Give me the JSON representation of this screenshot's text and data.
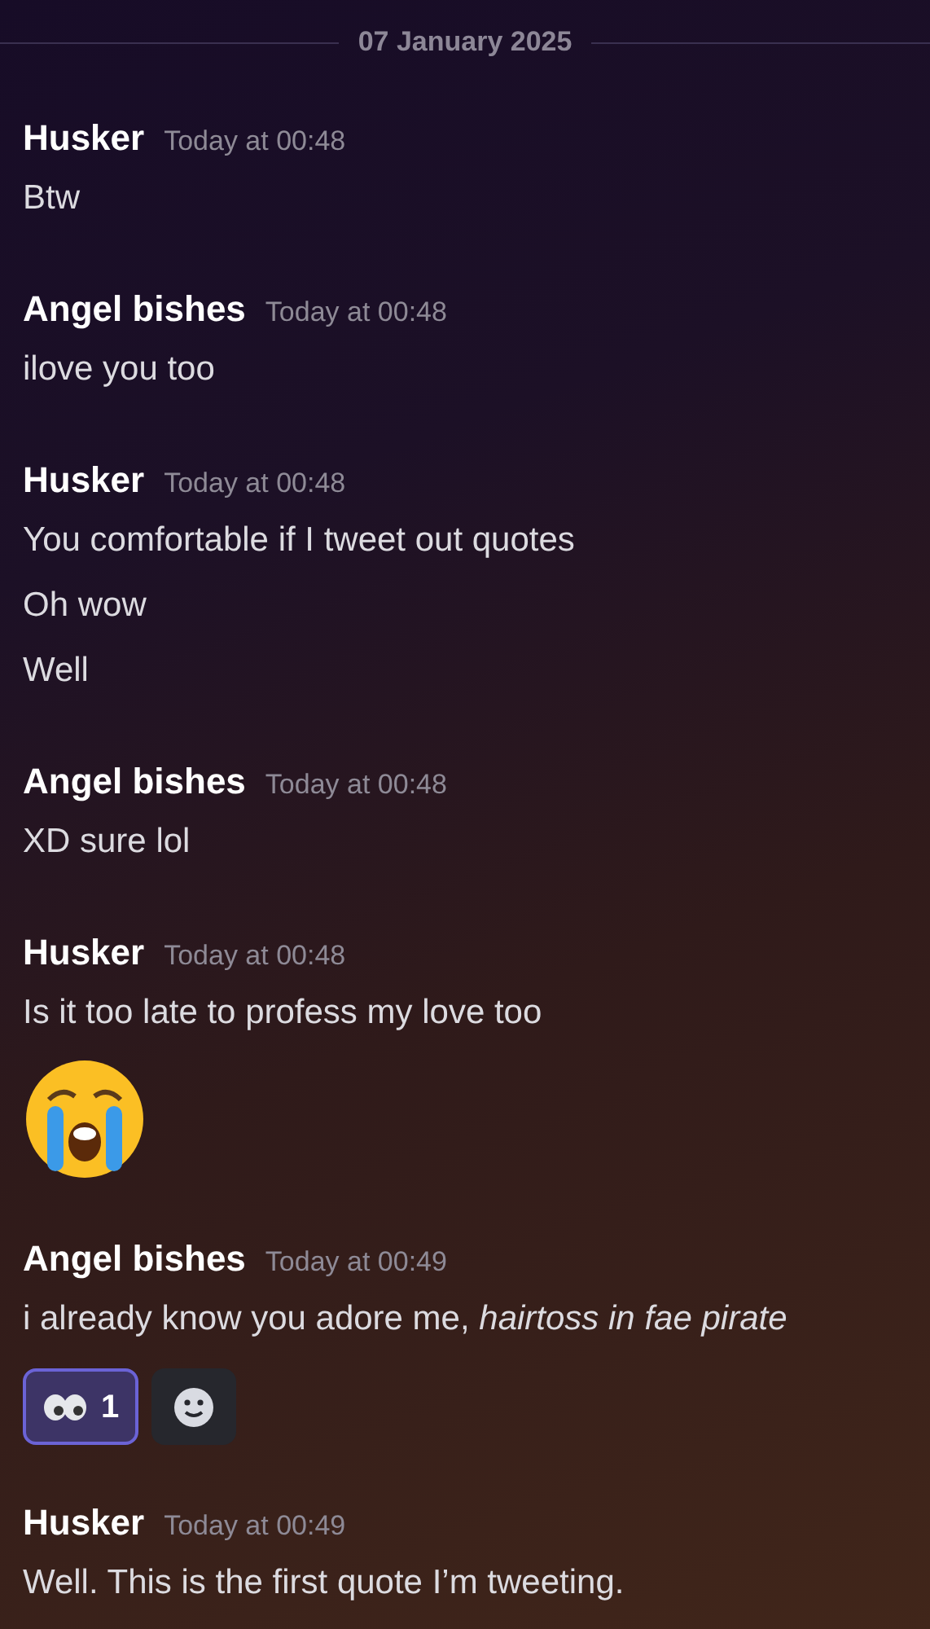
{
  "date_divider": "07 January 2025",
  "messages": [
    {
      "author": "Husker",
      "time": "Today at 00:48",
      "lines": [
        {
          "kind": "text",
          "text": "Btw"
        }
      ]
    },
    {
      "author": "Angel bishes",
      "time": "Today at 00:48",
      "lines": [
        {
          "kind": "text",
          "text": "ilove you too"
        }
      ]
    },
    {
      "author": "Husker",
      "time": "Today at 00:48",
      "lines": [
        {
          "kind": "text",
          "text": "You comfortable if I tweet out quotes"
        },
        {
          "kind": "text",
          "text": "Oh wow"
        },
        {
          "kind": "text",
          "text": "Well"
        }
      ]
    },
    {
      "author": "Angel bishes",
      "time": "Today at 00:48",
      "lines": [
        {
          "kind": "text",
          "text": "XD sure lol"
        }
      ]
    },
    {
      "author": "Husker",
      "time": "Today at 00:48",
      "lines": [
        {
          "kind": "text",
          "text": "Is it too late to profess my love too"
        },
        {
          "kind": "big_emoji"
        }
      ]
    },
    {
      "author": "Angel bishes",
      "time": "Today at 00:49",
      "lines": [
        {
          "kind": "text",
          "text": "i already know you adore me, *hairtoss in fae pirate*"
        }
      ],
      "reactions": [
        {
          "count": "1",
          "selected": true
        }
      ]
    },
    {
      "author": "Husker",
      "time": "Today at 00:49",
      "lines": [
        {
          "kind": "text",
          "text": "Well. This is the first quote I’m tweeting."
        }
      ]
    }
  ]
}
